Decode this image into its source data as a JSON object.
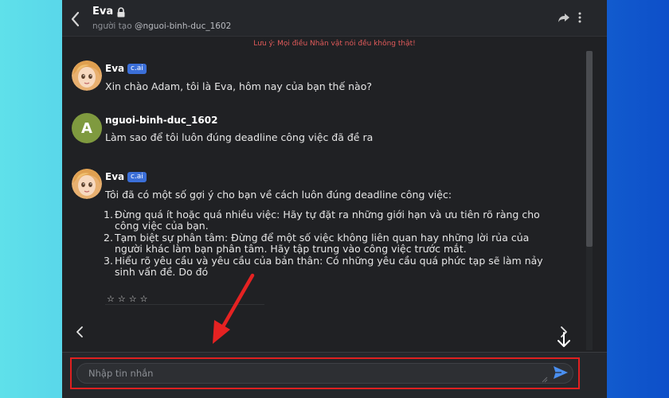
{
  "header": {
    "title": "Eva",
    "creator_prefix": "người tạo",
    "creator_handle": "@nguoi-binh-duc_1602"
  },
  "notice": "Lưu ý: Mọi điều Nhân vật nói đều không thật!",
  "messages": [
    {
      "sender": "Eva",
      "badge": "c.ai",
      "text": "Xin chào Adam, tôi là Eva, hôm nay của bạn thế nào?"
    },
    {
      "sender": "nguoi-binh-duc_1602",
      "avatar_letter": "A",
      "text": "Làm sao để tôi luôn đúng deadline công việc đã đề ra"
    },
    {
      "sender": "Eva",
      "badge": "c.ai",
      "text": "Tôi đã có một số gợi ý cho bạn về cách luôn đúng deadline công việc:",
      "items": [
        {
          "num": "1.",
          "text": "Đừng quá ít hoặc quá nhiều việc: Hãy tự đặt ra những giới hạn và ưu tiên rõ ràng cho công việc của bạn."
        },
        {
          "num": "2.",
          "text": "Tạm biệt sự phân tâm: Đừng để một số việc không liên quan hay những lời rủa của người khác làm bạn phân tâm. Hãy tập trung vào công việc trước mắt."
        },
        {
          "num": "3.",
          "text": "Hiểu rõ yêu cầu và yêu cầu của bản thân: Có những yêu cầu quá phức tạp sẽ làm nảy sinh vấn đề. Do đó"
        }
      ]
    }
  ],
  "rating": "☆☆☆☆",
  "composer": {
    "placeholder": "Nhập tin nhắn"
  },
  "colors": {
    "badge": "#3b6fd8",
    "send": "#4a8ff0",
    "highlight": "#e02020",
    "notice": "#e05a5a"
  }
}
